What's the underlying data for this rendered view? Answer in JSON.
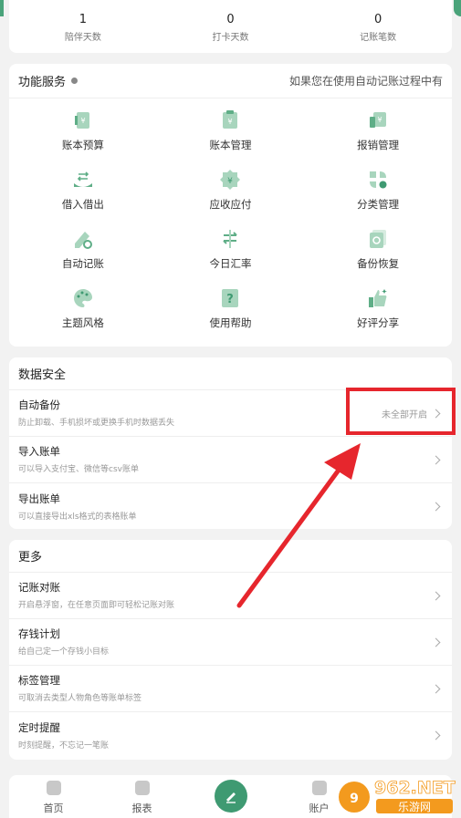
{
  "stats": [
    {
      "num": "1",
      "label": "陪伴天数"
    },
    {
      "num": "0",
      "label": "打卡天数"
    },
    {
      "num": "0",
      "label": "记账笔数"
    }
  ],
  "services": {
    "title": "功能服务",
    "marquee": "如果您在使用自动记账过程中有",
    "items": [
      {
        "label": "账本预算",
        "icon": "budget-book-icon"
      },
      {
        "label": "账本管理",
        "icon": "ledger-manage-icon"
      },
      {
        "label": "报销管理",
        "icon": "reimburse-icon"
      },
      {
        "label": "借入借出",
        "icon": "lend-borrow-icon"
      },
      {
        "label": "应收应付",
        "icon": "receivable-icon"
      },
      {
        "label": "分类管理",
        "icon": "category-icon"
      },
      {
        "label": "自动记账",
        "icon": "auto-record-icon"
      },
      {
        "label": "今日汇率",
        "icon": "exchange-rate-icon"
      },
      {
        "label": "备份恢复",
        "icon": "backup-restore-icon"
      },
      {
        "label": "主题风格",
        "icon": "palette-icon"
      },
      {
        "label": "使用帮助",
        "icon": "help-icon"
      },
      {
        "label": "好评分享",
        "icon": "thumbs-up-icon"
      }
    ]
  },
  "data_security": {
    "title": "数据安全",
    "rows": [
      {
        "title": "自动备份",
        "sub": "防止卸载、手机损坏或更换手机时数据丢失",
        "right": "未全部开启"
      },
      {
        "title": "导入账单",
        "sub": "可以导入支付宝、微信等csv账单",
        "right": ""
      },
      {
        "title": "导出账单",
        "sub": "可以直接导出xls格式的表格账单",
        "right": ""
      }
    ]
  },
  "more": {
    "title": "更多",
    "rows": [
      {
        "title": "记账对账",
        "sub": "开启悬浮窗，在任意页面即可轻松记账对账"
      },
      {
        "title": "存钱计划",
        "sub": "给自己定一个存钱小目标"
      },
      {
        "title": "标签管理",
        "sub": "可取消去类型人物角色等账单标签"
      },
      {
        "title": "定时提醒",
        "sub": "时刻提醒，不忘记一笔账"
      }
    ]
  },
  "tabbar": {
    "home": "首页",
    "report": "报表",
    "account": "账户"
  },
  "watermark": {
    "brand": "962.NET",
    "sub": "乐游网"
  },
  "colors": {
    "accent": "#3f9a72",
    "highlight": "#e6262d"
  }
}
